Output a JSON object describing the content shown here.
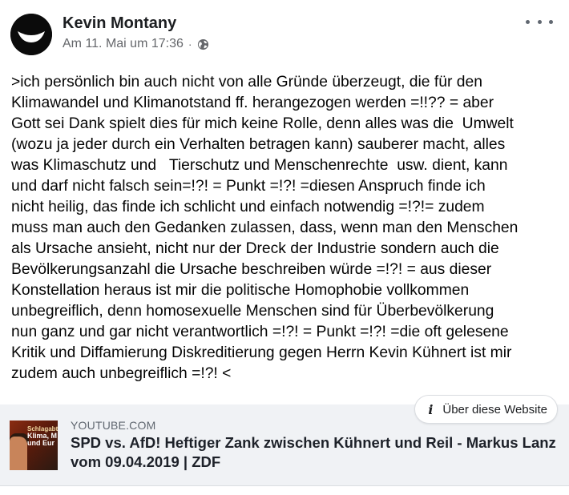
{
  "post": {
    "author": "Kevin Montany",
    "timestamp": "Am 11. Mai um 17:36",
    "separator": "·",
    "privacy_icon": "globe-icon",
    "more_icon": "more-options-icon",
    "text": ">ich persönlich bin auch nicht von alle Gründe überzeugt, die für den\nKlimawandel und Klimanotstand ff. herangezogen werden =!!?? = aber\nGott sei Dank spielt dies für mich keine Rolle, denn alles was die  Umwelt\n(wozu ja jeder durch ein Verhalten betragen kann) sauberer macht, alles\nwas Klimaschutz und   Tierschutz und Menschenrechte  usw. dient, kann\nund darf nicht falsch sein=!?! = Punkt =!?! =diesen Anspruch finde ich\nnicht heilig, das finde ich schlicht und einfach notwendig =!?!= zudem\nmuss man auch den Gedanken zulassen, dass, wenn man den Menschen\nals Ursache ansieht, nicht nur der Dreck der Industrie sondern auch die\nBevölkerungsanzahl die Ursache beschreiben würde =!?! = aus dieser\nKonstellation heraus ist mir die politische Homophobie vollkommen\nunbegreiflich, denn homosexuelle Menschen sind für Überbevölkerung\nnun ganz und gar nicht verantwortlich =!?! = Punkt =!?! =die oft gelesene\nKritik und Diffamierung Diskreditierung gegen Herrn Kevin Kühnert ist mir\nzudem auch unbegreiflich =!?! <"
  },
  "about_button": {
    "icon": "info-icon",
    "label": "Über diese Website"
  },
  "link_preview": {
    "site": "YOUTUBE.COM",
    "title": "SPD vs. AfD! Heftiger Zank zwischen Kühnert und Reil - Markus Lanz vom 09.04.2019 | ZDF",
    "thumbnail_text": [
      "Schlagabtausch",
      "Klima, M",
      "und Eur"
    ]
  }
}
